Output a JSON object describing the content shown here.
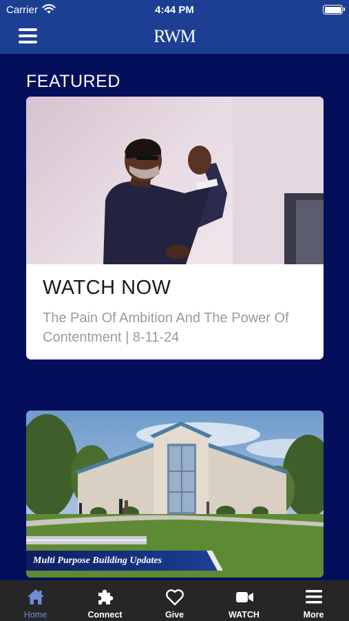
{
  "status_bar": {
    "carrier": "Carrier",
    "time": "4:44 PM"
  },
  "header": {
    "logo_text": "RWM"
  },
  "featured": {
    "section_title": "FEATURED",
    "card": {
      "heading": "WATCH NOW",
      "subtitle": "The Pain Of Ambition And The Power Of Contentment | 8-11-24"
    }
  },
  "second_card": {
    "banner_text": "Multi Purpose Building Updates"
  },
  "tab_bar": {
    "active": "home",
    "tabs": [
      {
        "label": "Home",
        "icon": "home-icon"
      },
      {
        "label": "Connect",
        "icon": "puzzle-icon"
      },
      {
        "label": "Give",
        "icon": "heart-icon"
      },
      {
        "label": "WATCH",
        "icon": "video-camera-icon"
      },
      {
        "label": "More",
        "icon": "menu-icon"
      }
    ]
  },
  "colors": {
    "background": "#040f5c",
    "header": "#1d3f93",
    "tab_bar": "#262626",
    "tab_active": "#6f8ed6"
  }
}
